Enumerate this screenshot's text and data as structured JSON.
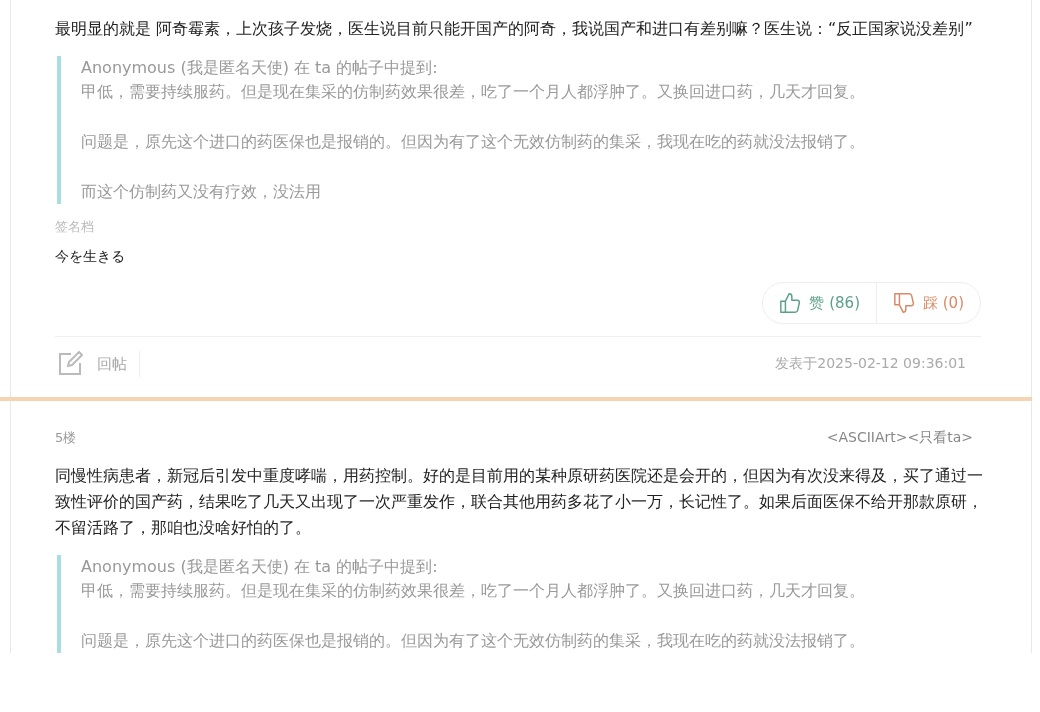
{
  "posts": [
    {
      "body": "最明显的就是 阿奇霉素，上次孩子发烧，医生说目前只能开国产的阿奇，我说国产和进口有差别嘛？医生说：“反正国家说没差别”",
      "quote": {
        "author": "Anonymous (我是匿名天使) 在 ta 的帖子中提到:",
        "paragraphs": [
          "甲低，需要持续服药。但是现在集采的仿制药效果很差，吃了一个月人都浮肿了。又换回进口药，几天才回复。",
          "问题是，原先这个进口的药医保也是报销的。但因为有了这个无效仿制药的集采，我现在吃的药就没法报销了。",
          "而这个仿制药又没有疗效，没法用"
        ]
      },
      "signature_label": "签名档",
      "signature": "今を生きる",
      "votes": {
        "like": "赞 (86)",
        "dislike": "踩 (0)"
      },
      "reply": "回帖",
      "posted": "发表于2025-02-12 09:36:01"
    },
    {
      "floor": "5楼",
      "links": "<ASCIIArt><只看ta>",
      "body": "同慢性病患者，新冠后引发中重度哮喘，用药控制。好的是目前用的某种原研药医院还是会开的，但因为有次没来得及，买了通过一致性评价的国产药，结果吃了几天又出现了一次严重发作，联合其他用药多花了小一万，长记性了。如果后面医保不给开那款原研，不留活路了，那咱也没啥好怕的了。",
      "quote": {
        "author": "Anonymous (我是匿名天使) 在 ta 的帖子中提到:",
        "paragraphs": [
          "甲低，需要持续服药。但是现在集采的仿制药效果很差，吃了一个月人都浮肿了。又换回进口药，几天才回复。",
          "问题是，原先这个进口的药医保也是报销的。但因为有了这个无效仿制药的集采，我现在吃的药就没法报销了。"
        ]
      }
    }
  ]
}
